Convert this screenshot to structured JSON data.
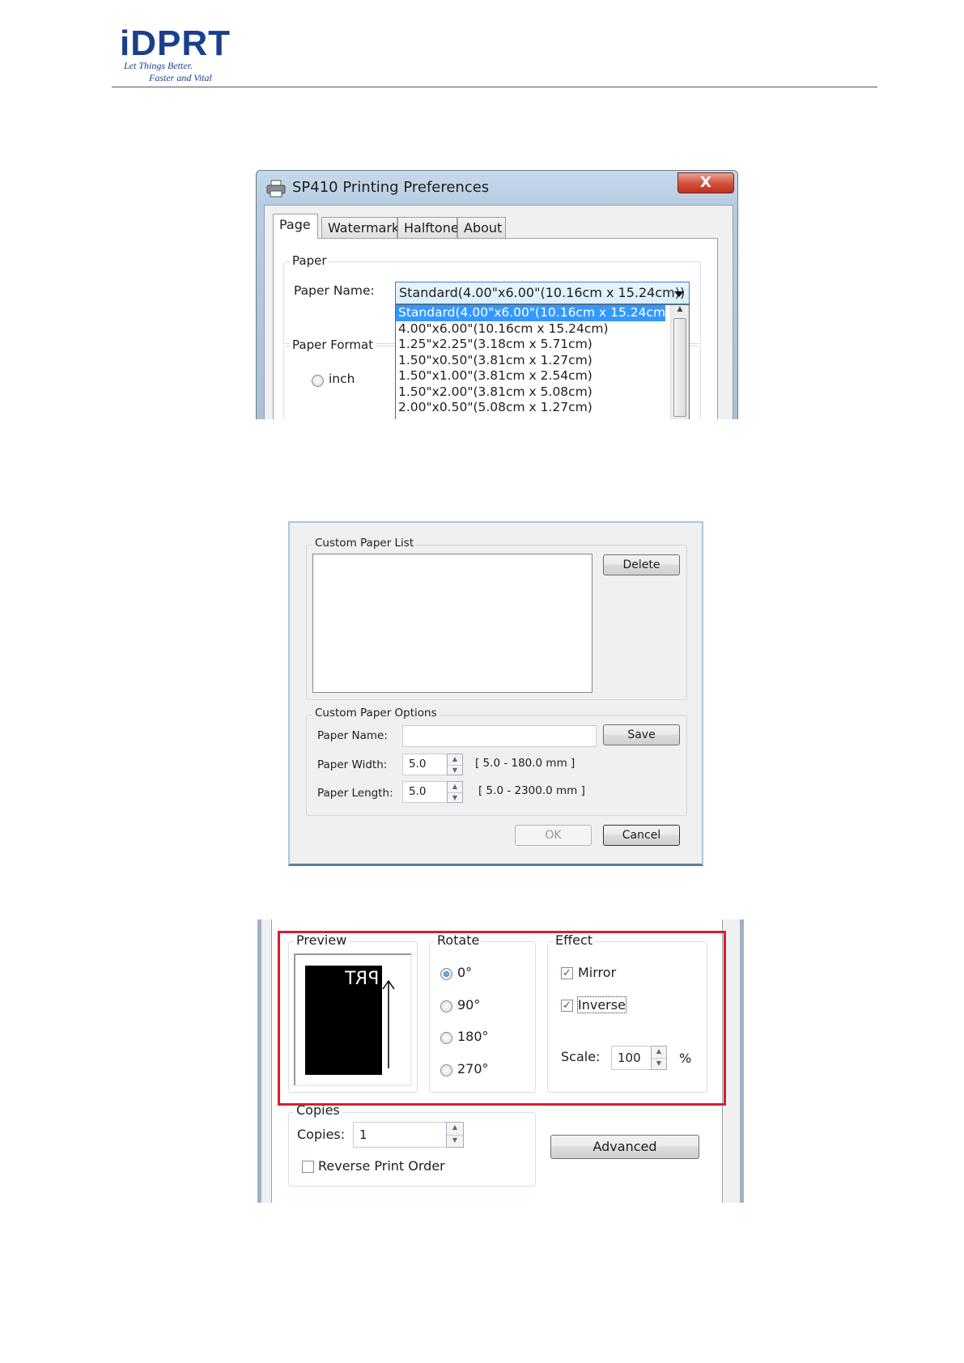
{
  "header": {
    "logo": "iDPRT",
    "tagline_1": "Let Things Better.",
    "tagline_2": "Faster and Vital"
  },
  "dialog_preferences": {
    "title": "SP410 Printing Preferences",
    "close_label": "X",
    "tabs": [
      "Page",
      "Watermark",
      "Halftone",
      "About"
    ],
    "paper_group": "Paper",
    "paper_name_label": "Paper Name:",
    "paper_name_selected": "Standard(4.00\"x6.00\"(10.16cm x 15.24cm))",
    "paper_list": [
      "Standard(4.00\"x6.00\"(10.16cm x 15.24cm))",
      "4.00\"x6.00\"(10.16cm x 15.24cm)",
      "1.25\"x2.25\"(3.18cm x 5.71cm)",
      "1.50\"x0.50\"(3.81cm x 1.27cm)",
      "1.50\"x1.00\"(3.81cm x 2.54cm)",
      "1.50\"x2.00\"(3.81cm x 5.08cm)",
      "2.00\"x0.50\"(5.08cm x 1.27cm)"
    ],
    "paper_format_group": "Paper Format",
    "unit_inch": "inch"
  },
  "dialog_custom_paper": {
    "list_group": "Custom Paper List",
    "delete_button": "Delete",
    "options_group": "Custom Paper Options",
    "paper_name_label": "Paper Name:",
    "paper_name_value": "",
    "save_button": "Save",
    "paper_width_label": "Paper Width:",
    "paper_width_value": "5.0",
    "paper_width_range": "[ 5.0 - 180.0 mm ]",
    "paper_length_label": "Paper Length:",
    "paper_length_value": "5.0",
    "paper_length_range": "[ 5.0 - 2300.0 mm ]",
    "ok_button": "OK",
    "cancel_button": "Cancel"
  },
  "page_settings": {
    "preview_group": "Preview",
    "preview_text": "PRT",
    "rotate_group": "Rotate",
    "rotate_options": [
      "0°",
      "90°",
      "180°",
      "270°"
    ],
    "rotate_selected": "0°",
    "effect_group": "Effect",
    "mirror_label": "Mirror",
    "mirror_checked": true,
    "inverse_label": "Inverse",
    "inverse_checked": true,
    "scale_label": "Scale:",
    "scale_value": "100",
    "scale_unit": "%",
    "copies_group": "Copies",
    "copies_label": "Copies:",
    "copies_value": "1",
    "reverse_print_label": "Reverse Print Order",
    "reverse_print_checked": false,
    "advanced_button": "Advanced",
    "highlight_color": "#d4202c"
  }
}
